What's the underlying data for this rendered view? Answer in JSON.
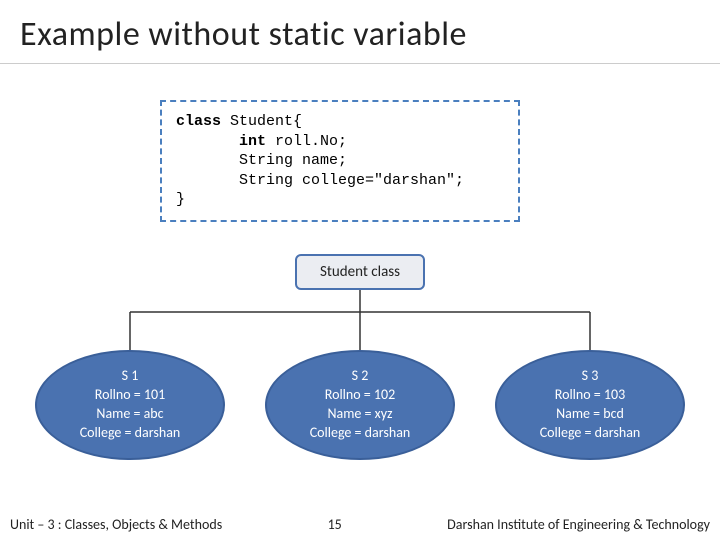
{
  "title": "Example without static variable",
  "code": {
    "l1a": "class",
    "l1b": " Student{",
    "l2a": "int",
    "l2b": " roll.No;",
    "l3": "String name;",
    "l4": "String college=\"darshan\";",
    "l5": "}"
  },
  "class_label": "Student class",
  "students": [
    {
      "id": "S 1",
      "roll": "Rollno = 101",
      "name": "Name = abc",
      "college": "College = darshan"
    },
    {
      "id": "S 2",
      "roll": "Rollno = 102",
      "name": "Name = xyz",
      "college": "College = darshan"
    },
    {
      "id": "S 3",
      "roll": "Rollno = 103",
      "name": "Name = bcd",
      "college": "College = darshan"
    }
  ],
  "footer": {
    "left": "Unit – 3 : Classes, Objects & Methods",
    "mid": "15",
    "right": "Darshan Institute of Engineering & Technology"
  }
}
